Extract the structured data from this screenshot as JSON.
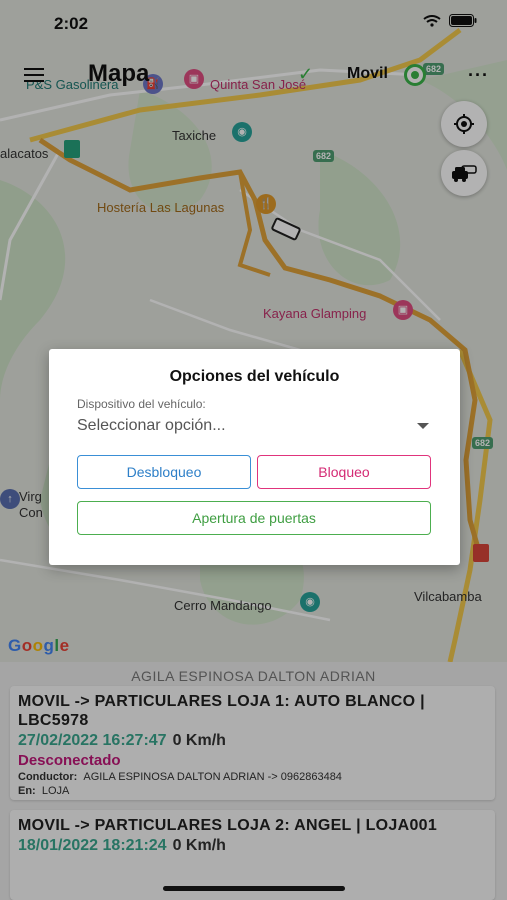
{
  "status_bar": {
    "time": "2:02"
  },
  "app_bar": {
    "title": "Mapa",
    "vehicle_label": "Movil"
  },
  "map": {
    "pois": {
      "gas": "P&S Gasolinera",
      "quinta": "Quinta San José",
      "taxiche": "Taxiche",
      "malacatos": "alacatos",
      "hosteria": "Hostería Las Lagunas",
      "kayana": "Kayana Glamping",
      "virgen": "Virg",
      "con": "Con",
      "cerro": "Cerro Mandango",
      "vilcabamba": "Vilcabamba"
    },
    "road_shields": [
      "682",
      "682",
      "682"
    ],
    "google": [
      "G",
      "o",
      "o",
      "g",
      "l",
      "e"
    ]
  },
  "dialog": {
    "title": "Opciones del vehículo",
    "field_label": "Dispositivo del vehículo:",
    "select_value": "Seleccionar opción...",
    "btn_unlock": "Desbloqueo",
    "btn_lock": "Bloqueo",
    "btn_doors": "Apertura de puertas"
  },
  "list": {
    "owner": "AGILA ESPINOSA DALTON ADRIAN",
    "items": [
      {
        "title": "MOVIL -> PARTICULARES LOJA 1: AUTO BLANCO | LBC5978",
        "datetime": "27/02/2022 16:27:47",
        "speed": "0 Km/h",
        "state": "Desconectado",
        "driver_label": "Conductor:",
        "driver": "AGILA ESPINOSA DALTON ADRIAN -> 0962863484",
        "location_label": "En:",
        "location": "LOJA"
      },
      {
        "title": "MOVIL -> PARTICULARES LOJA 2: ANGEL | LOJA001",
        "datetime": "18/01/2022 18:21:24",
        "speed": "0 Km/h"
      }
    ]
  },
  "colors": {
    "accent_blue": "#3a8fd6",
    "accent_pink": "#e0347c",
    "accent_green": "#4cae4f",
    "datetime_green": "#3aa68e",
    "state_magenta": "#c2187a",
    "route": "#e0a23a"
  }
}
